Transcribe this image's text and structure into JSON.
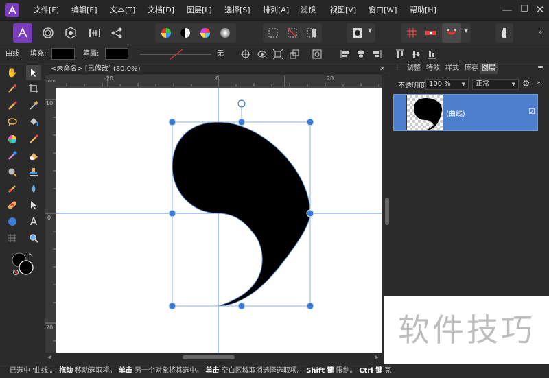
{
  "menu": {
    "items": [
      "文件[F]",
      "编辑[E]",
      "文本[T]",
      "文档[D]",
      "图层[L]",
      "选择[S]",
      "排列[A]",
      "滤镜",
      "视图[V]",
      "窗口[W]",
      "帮助[H]"
    ]
  },
  "window_controls": {
    "minimize": "—",
    "maximize": "☐",
    "close": "✕"
  },
  "context_toolbar": {
    "tool_name": "曲线",
    "fill_label": "填充:",
    "stroke_label": "笔画:",
    "stroke_value": "无",
    "fill_color": "#000000",
    "stroke_color": "#000000"
  },
  "document": {
    "tab_title": "<未命名> [已修改] (80.0%)",
    "close": "✕",
    "ruler_unit": "mm",
    "ruler_h_labels": [
      "-20",
      "0",
      "20"
    ],
    "ruler_v_labels": [
      "10",
      "0",
      "10",
      "20"
    ]
  },
  "panel": {
    "tabs": [
      "调整",
      "特效",
      "样式",
      "库存",
      "图层"
    ],
    "active_tab": "图层",
    "menu_icon": "≡",
    "opacity_label": "不透明度:",
    "opacity_value": "100 %",
    "blend_mode": "正常",
    "layers": [
      {
        "name": "(曲线)",
        "visible": "☑"
      }
    ]
  },
  "status_bar": {
    "segments": [
      {
        "t": "已选中 '曲线'。",
        "b": false
      },
      {
        "t": " 拖动",
        "b": true
      },
      {
        "t": " 移动选取项。",
        "b": false
      },
      {
        "t": " 单击",
        "b": true
      },
      {
        "t": " 另一个对象将其选中。",
        "b": false
      },
      {
        "t": " 单击",
        "b": true
      },
      {
        "t": " 空白区域取消选择选取项。",
        "b": false
      },
      {
        "t": " Shift 键",
        "b": true
      },
      {
        "t": " 限制。",
        "b": false
      },
      {
        "t": " Ctrl 键",
        "b": true
      },
      {
        "t": " 克",
        "b": false
      }
    ]
  },
  "watermark": "软件技巧",
  "colors": {
    "accent": "#4d7fcc",
    "selection_handle": "#3a7bd5",
    "app_logo": "#7b3dbd"
  }
}
